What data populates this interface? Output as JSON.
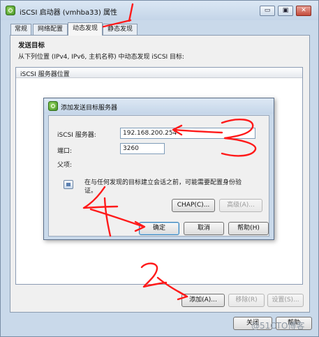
{
  "window": {
    "title": "iSCSI 启动器 (vmhba33) 属性",
    "btn_min": "▭",
    "btn_max": "▣",
    "btn_close": "✕"
  },
  "tabs": [
    {
      "label": "常规"
    },
    {
      "label": "网络配置"
    },
    {
      "label": "动态发现",
      "active": true
    },
    {
      "label": "静态发现"
    }
  ],
  "main": {
    "section_title": "发送目标",
    "description": "从下列位置 (IPv4, IPv6, 主机名称) 中动态发现 iSCSI 目标:",
    "list_header": "iSCSI 服务器位置",
    "buttons": {
      "add": "添加(A)...",
      "remove": "移除(R)",
      "settings": "设置(S)..."
    },
    "bottom_buttons": {
      "close": "关闭",
      "help": "帮助"
    }
  },
  "dialog": {
    "title": "添加发送目标服务器",
    "server_label": "iSCSI 服务器:",
    "server_value": "192.168.200.254",
    "port_label": "端口:",
    "port_value": "3260",
    "parent_label": "父项:",
    "info_text_line1": "在与任何发现的目标建立会话之前，可能需要配置身份验",
    "info_text_line2": "证。",
    "chap_button": "CHAP(C)...",
    "advanced_button": "高级(A)...",
    "ok_button": "确定",
    "cancel_button": "取消",
    "help_button": "帮助(H)"
  },
  "annotations": {
    "mark1": "1",
    "mark2": "2",
    "mark3": "3",
    "mark4": "4"
  },
  "watermark": "@51CTO博客",
  "colors": {
    "annotation": "#ff1a1a",
    "chrome": "#c9d9ea"
  },
  "icons": {
    "app": "iscsi-app-icon",
    "dialog": "iscsi-dialog-icon",
    "info": "info-icon"
  }
}
